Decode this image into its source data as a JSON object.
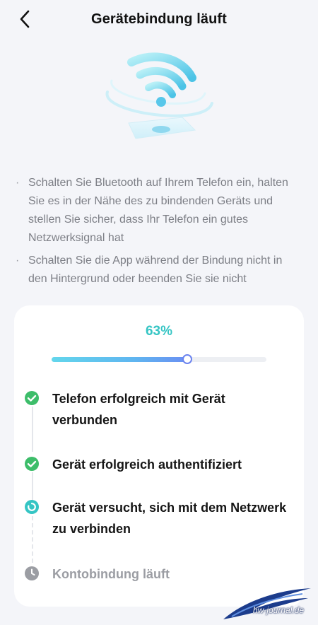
{
  "header": {
    "title": "Gerätebindung läuft"
  },
  "instructions": [
    {
      "bullet": "·",
      "text": "Schalten Sie Bluetooth auf Ihrem Telefon ein, halten Sie es in der Nähe des zu bindenden Geräts und stellen Sie sicher, dass Ihr Telefon ein gutes Netzwerksignal hat"
    },
    {
      "bullet": "·",
      "text": "Schalten Sie die App während der Bindung nicht in den Hintergrund oder beenden Sie sie nicht"
    }
  ],
  "progress": {
    "percent_label": "63%",
    "fraction": 0.63
  },
  "steps": [
    {
      "label": "Telefon erfolgreich mit Gerät verbunden",
      "status": "done"
    },
    {
      "label": "Gerät erfolgreich authentifiziert",
      "status": "done"
    },
    {
      "label": "Gerät versucht, sich mit dem Netzwerk zu verbinden",
      "status": "in-progress"
    },
    {
      "label": "Kontobindung läuft",
      "status": "pending"
    }
  ],
  "colors": {
    "done": "#3dbd6a",
    "in_progress": "#35c5c4",
    "pending": "#9b9da3",
    "accent": "#35c5c4"
  },
  "icons": {
    "back": "chevron-left-icon",
    "done": "check-circle-icon",
    "in_progress": "loading-icon",
    "pending": "clock-icon"
  },
  "watermark": {
    "text": "hw-journal.de"
  }
}
